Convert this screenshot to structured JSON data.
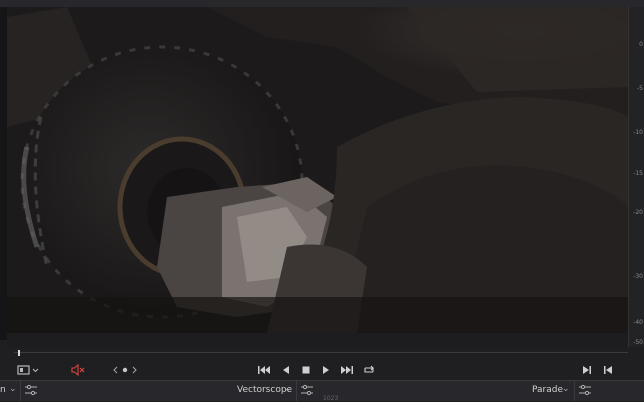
{
  "viewer": {
    "meter_ticks": [
      "0",
      "-5",
      "-10",
      "-15",
      "-20",
      "-30",
      "-40",
      "-50"
    ]
  },
  "transport": {
    "mute_color": "#e0443a",
    "icons": [
      "viewer-mode-icon",
      "mute-icon",
      "jog-prev-icon",
      "jog-next-icon",
      "skip-to-start-icon",
      "play-reverse-icon",
      "stop-icon",
      "play-icon",
      "skip-to-end-icon",
      "loop-icon",
      "prev-clip-icon",
      "next-clip-icon"
    ]
  },
  "bottom": {
    "left_partial": "n",
    "scope_left": "Vectorscope",
    "scope_right": "Parade",
    "cut_number": "1023"
  }
}
